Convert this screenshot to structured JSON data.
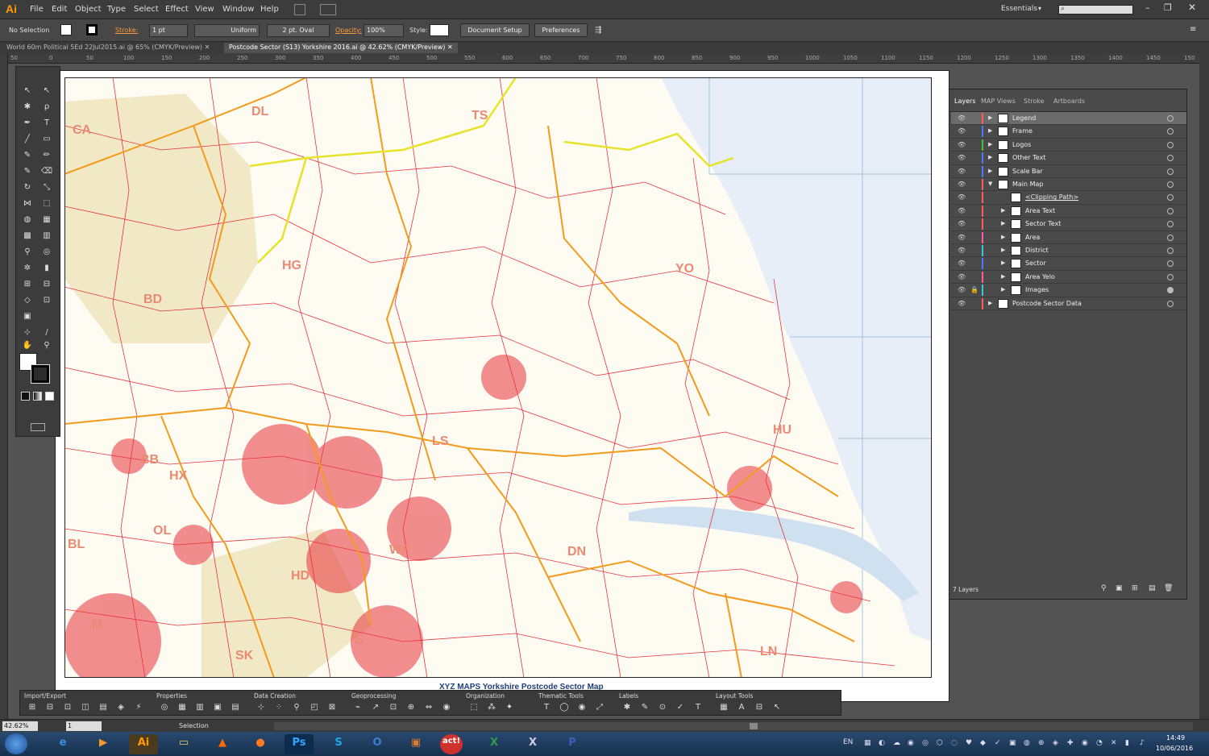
{
  "app": {
    "logo": "Ai"
  },
  "menu": [
    "File",
    "Edit",
    "Object",
    "Type",
    "Select",
    "Effect",
    "View",
    "Window",
    "Help"
  ],
  "workspace": {
    "label": "Essentials"
  },
  "control": {
    "selection": "No Selection",
    "stroke_label": "Stroke:",
    "stroke_weight": "1 pt",
    "profile": "Uniform",
    "brush": "2 pt. Oval",
    "opacity_label": "Opacity:",
    "opacity": "100%",
    "style_label": "Style:",
    "document_setup": "Document Setup",
    "preferences": "Preferences"
  },
  "tabs": [
    {
      "label": "World 60m Political 5Ed 22Jul2015.ai @ 65% (CMYK/Preview)"
    },
    {
      "label": "Postcode Sector (S13) Yorkshire 2016.ai @ 42.62% (CMYK/Preview)"
    }
  ],
  "ruler": [
    "50",
    "0",
    "50",
    "100",
    "150",
    "200",
    "250",
    "300",
    "350",
    "400",
    "450",
    "500",
    "550",
    "600",
    "650",
    "700",
    "750",
    "800",
    "850",
    "900",
    "950",
    "1000",
    "1050",
    "1100",
    "1150",
    "1200",
    "1250",
    "1300",
    "1350",
    "1400",
    "1450",
    "150"
  ],
  "map": {
    "areas": [
      "DL",
      "TS",
      "CA",
      "HG",
      "YO",
      "BD",
      "LS",
      "BB",
      "HX",
      "HU",
      "OL",
      "WF",
      "DN",
      "HD",
      "BL",
      "M",
      "S",
      "SK",
      "LN"
    ],
    "footer_title": "XYZ MAPS  Yorkshire Postcode Sector Map",
    "sea_color": "#e8eef8",
    "road_red": "#e8323c",
    "boundary_orange": "#f39a1c"
  },
  "layers_panel": {
    "tabs": [
      "Layers",
      "MAP Views",
      "Stroke",
      "Artboards"
    ],
    "rows": [
      {
        "name": "Legend",
        "color": "#ff5b5b",
        "indent": 0,
        "expanded": false,
        "selected": true
      },
      {
        "name": "Frame",
        "color": "#4a7cf7",
        "indent": 0,
        "expanded": false,
        "selected": false
      },
      {
        "name": "Logos",
        "color": "#3fc33f",
        "indent": 0,
        "expanded": false,
        "selected": false
      },
      {
        "name": "Other Text",
        "color": "#4a7cf7",
        "indent": 0,
        "expanded": false,
        "selected": false
      },
      {
        "name": "Scale Bar",
        "color": "#4a7cf7",
        "indent": 0,
        "expanded": false,
        "selected": false
      },
      {
        "name": "Main Map",
        "color": "#ff5b5b",
        "indent": 0,
        "expanded": true,
        "selected": false
      },
      {
        "name": "<Clipping Path>",
        "color": "#ff5b5b",
        "indent": 1,
        "expanded": false,
        "selected": false
      },
      {
        "name": "Area Text",
        "color": "#ff5b5b",
        "indent": 1,
        "expanded": false,
        "selected": false
      },
      {
        "name": "Sector Text",
        "color": "#ff5b5b",
        "indent": 1,
        "expanded": false,
        "selected": false
      },
      {
        "name": "Area",
        "color": "#ff5ba8",
        "indent": 1,
        "expanded": false,
        "selected": false
      },
      {
        "name": "District",
        "color": "#35c6e0",
        "indent": 1,
        "expanded": false,
        "selected": false
      },
      {
        "name": "Sector",
        "color": "#4a7cf7",
        "indent": 1,
        "expanded": false,
        "selected": false
      },
      {
        "name": "Area Yelo",
        "color": "#ff5ba8",
        "indent": 1,
        "expanded": false,
        "selected": false
      },
      {
        "name": "Images",
        "color": "#35c6e0",
        "indent": 1,
        "expanded": false,
        "selected": false
      },
      {
        "name": "Postcode Sector Data",
        "color": "#ff5b5b",
        "indent": 0,
        "expanded": false,
        "selected": false
      }
    ],
    "count": "7 Layers"
  },
  "bottom_toolbar": {
    "groups": [
      "Import/Export",
      "Properties",
      "Data Creation",
      "Geoprocessing",
      "Organization",
      "Thematic Tools",
      "Labels",
      "Layout Tools"
    ]
  },
  "status": {
    "zoom": "42.62%",
    "page": "1",
    "tool": "Selection"
  },
  "taskbar": {
    "apps": [
      "Ai",
      "Ps",
      "act!"
    ],
    "lang": "EN",
    "time": "14:49",
    "date": "10/06/2016"
  }
}
